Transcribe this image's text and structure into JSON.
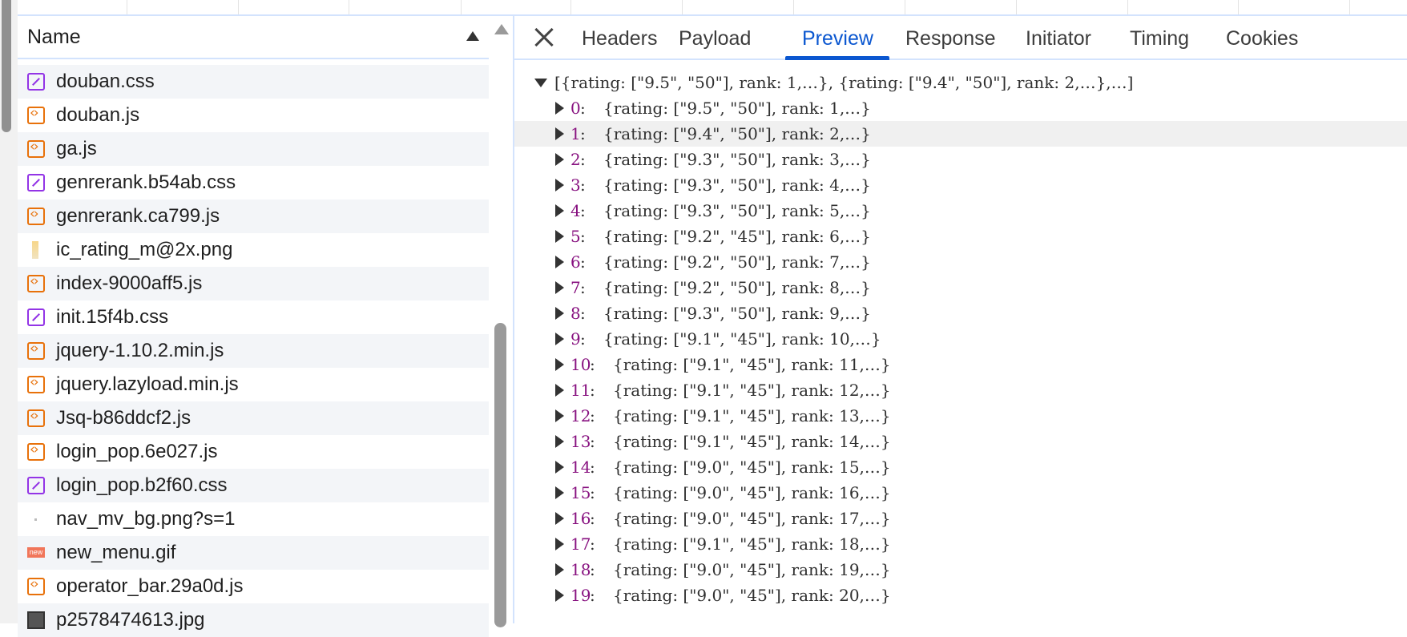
{
  "file_list": {
    "header": "Name",
    "items": [
      {
        "name": "douban.css",
        "type": "css"
      },
      {
        "name": "douban.js",
        "type": "js"
      },
      {
        "name": "ga.js",
        "type": "js"
      },
      {
        "name": "genrerank.b54ab.css",
        "type": "css"
      },
      {
        "name": "genrerank.ca799.js",
        "type": "js"
      },
      {
        "name": "ic_rating_m@2x.png",
        "type": "png"
      },
      {
        "name": "index-9000aff5.js",
        "type": "js"
      },
      {
        "name": "init.15f4b.css",
        "type": "css"
      },
      {
        "name": "jquery-1.10.2.min.js",
        "type": "js"
      },
      {
        "name": "jquery.lazyload.min.js",
        "type": "js"
      },
      {
        "name": "Jsq-b86ddcf2.js",
        "type": "js"
      },
      {
        "name": "login_pop.6e027.js",
        "type": "js"
      },
      {
        "name": "login_pop.b2f60.css",
        "type": "css"
      },
      {
        "name": "nav_mv_bg.png?s=1",
        "type": "dot"
      },
      {
        "name": "new_menu.gif",
        "type": "gif"
      },
      {
        "name": "operator_bar.29a0d.js",
        "type": "js"
      },
      {
        "name": "p2578474613.jpg",
        "type": "jpg"
      }
    ]
  },
  "tabs": {
    "items": [
      {
        "label": "Headers",
        "active": false
      },
      {
        "label": "Payload",
        "active": false
      },
      {
        "label": "Preview",
        "active": true
      },
      {
        "label": "Response",
        "active": false
      },
      {
        "label": "Initiator",
        "active": false
      },
      {
        "label": "Timing",
        "active": false
      },
      {
        "label": "Cookies",
        "active": false
      }
    ]
  },
  "preview": {
    "root": "[{rating: [\"9.5\", \"50\"], rank: 1,…}, {rating: [\"9.4\", \"50\"], rank: 2,…},…]",
    "entries": [
      {
        "index": "0",
        "text": "{rating: [\"9.5\", \"50\"], rank: 1,…}"
      },
      {
        "index": "1",
        "text": "{rating: [\"9.4\", \"50\"], rank: 2,…}"
      },
      {
        "index": "2",
        "text": "{rating: [\"9.3\", \"50\"], rank: 3,…}"
      },
      {
        "index": "3",
        "text": "{rating: [\"9.3\", \"50\"], rank: 4,…}"
      },
      {
        "index": "4",
        "text": "{rating: [\"9.3\", \"50\"], rank: 5,…}"
      },
      {
        "index": "5",
        "text": "{rating: [\"9.2\", \"45\"], rank: 6,…}"
      },
      {
        "index": "6",
        "text": "{rating: [\"9.2\", \"50\"], rank: 7,…}"
      },
      {
        "index": "7",
        "text": "{rating: [\"9.2\", \"50\"], rank: 8,…}"
      },
      {
        "index": "8",
        "text": "{rating: [\"9.3\", \"50\"], rank: 9,…}"
      },
      {
        "index": "9",
        "text": "{rating: [\"9.1\", \"45\"], rank: 10,…}"
      },
      {
        "index": "10",
        "text": "{rating: [\"9.1\", \"45\"], rank: 11,…}"
      },
      {
        "index": "11",
        "text": "{rating: [\"9.1\", \"45\"], rank: 12,…}"
      },
      {
        "index": "12",
        "text": "{rating: [\"9.1\", \"45\"], rank: 13,…}"
      },
      {
        "index": "13",
        "text": "{rating: [\"9.1\", \"45\"], rank: 14,…}"
      },
      {
        "index": "14",
        "text": "{rating: [\"9.0\", \"45\"], rank: 15,…}"
      },
      {
        "index": "15",
        "text": "{rating: [\"9.0\", \"45\"], rank: 16,…}"
      },
      {
        "index": "16",
        "text": "{rating: [\"9.0\", \"45\"], rank: 17,…}"
      },
      {
        "index": "17",
        "text": "{rating: [\"9.1\", \"45\"], rank: 18,…}"
      },
      {
        "index": "18",
        "text": "{rating: [\"9.0\", \"45\"], rank: 19,…}"
      },
      {
        "index": "19",
        "text": "{rating: [\"9.0\", \"45\"], rank: 20,…}"
      }
    ],
    "highlighted_index": "1"
  },
  "colors": {
    "accent": "#0b57d0",
    "index_key": "#881280",
    "css_icon": "#9334e6",
    "js_icon": "#e8710a"
  },
  "icons": {
    "close": "close-icon",
    "sort": "sort-ascending-icon",
    "expand": "triangle-down-icon",
    "collapse": "triangle-right-icon"
  }
}
